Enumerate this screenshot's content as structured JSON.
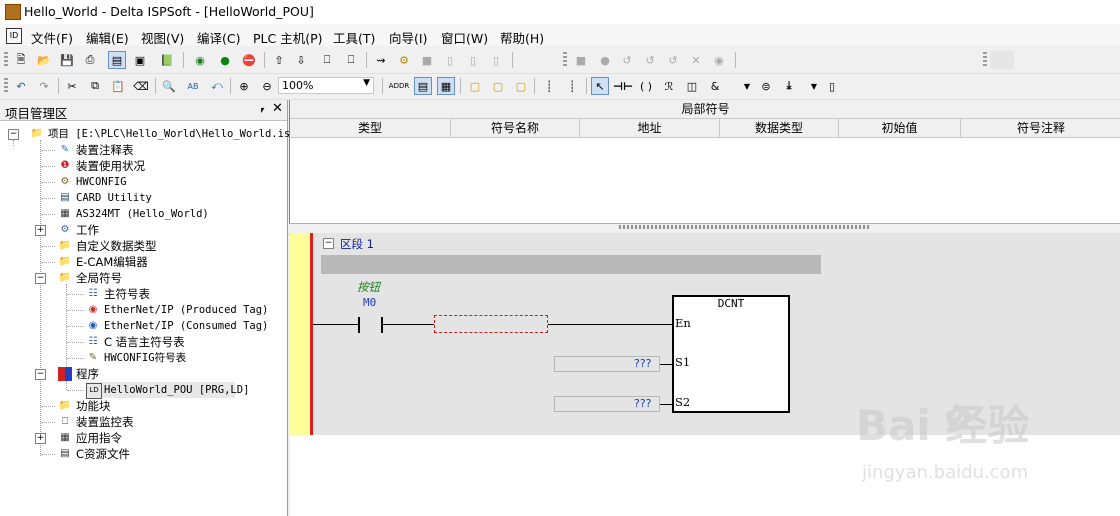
{
  "window": {
    "title": "Hello_World - Delta ISPSoft - [HelloWorld_POU]"
  },
  "menu": [
    "文件(F)",
    "编辑(E)",
    "视图(V)",
    "编译(C)",
    "PLC 主机(P)",
    "工具(T)",
    "向导(I)",
    "窗口(W)",
    "帮助(H)"
  ],
  "toolbar": {
    "zoom_value": "100%"
  },
  "project_panel": {
    "title": "项目管理区",
    "root": "项目 [E:\\PLC\\Hello_World\\Hello_World.is",
    "items": [
      "装置注释表",
      "装置使用状况",
      "HWCONFIG",
      "CARD Utility",
      "AS324MT  (Hello_World)",
      "工作",
      "自定义数据类型",
      "E-CAM编辑器",
      "全局符号",
      "主符号表",
      "EtherNet/IP (Produced Tag)",
      "EtherNet/IP (Consumed Tag)",
      "C 语言主符号表",
      "HWCONFIG符号表",
      "程序",
      "HelloWorld_POU [PRG,LD]",
      "功能块",
      "装置监控表",
      "应用指令",
      "C资源文件"
    ]
  },
  "local_symbols": {
    "title": "局部符号",
    "columns": [
      "类型",
      "符号名称",
      "地址",
      "数据类型",
      "初始值",
      "符号注释"
    ]
  },
  "ladder": {
    "section_label": "区段 1",
    "contact_comment": "按钮",
    "contact_device": "M0",
    "block_name": "DCNT",
    "pins": [
      "En",
      "S1",
      "S2"
    ],
    "s1_value": "???",
    "s2_value": "???"
  },
  "watermark": {
    "brand": "Bai  经验",
    "url": "jingyan.baidu.com"
  }
}
